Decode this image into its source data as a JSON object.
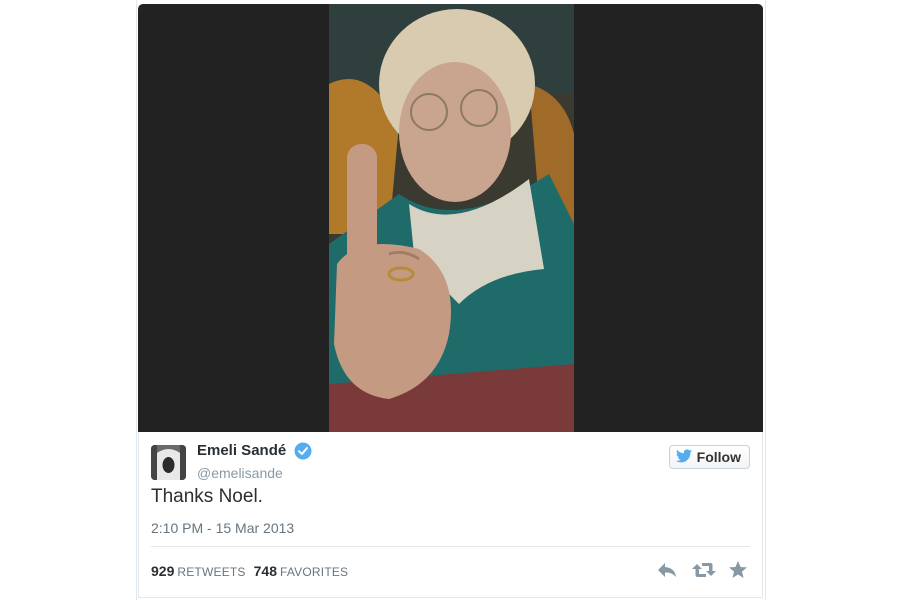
{
  "media": {
    "alt_icon": "photo-image"
  },
  "tweet": {
    "author_name": "Emeli Sandé",
    "author_handle": "@emelisande",
    "verified_icon": "verified-badge-icon",
    "text": "Thanks Noel.",
    "timestamp": "2:10 PM - 15 Mar 2013",
    "follow_label": "Follow",
    "follow_icon": "twitter-bird-icon",
    "retweets_count": "929",
    "retweets_label": "RETWEETS",
    "favorites_count": "748",
    "favorites_label": "FAVORITES",
    "actions": [
      "reply-icon",
      "retweet-icon",
      "favorite-star-icon"
    ]
  },
  "colors": {
    "verified": "#55acee",
    "twitter_blue": "#55acee",
    "text": "#292f33",
    "muted": "#8899a6"
  }
}
